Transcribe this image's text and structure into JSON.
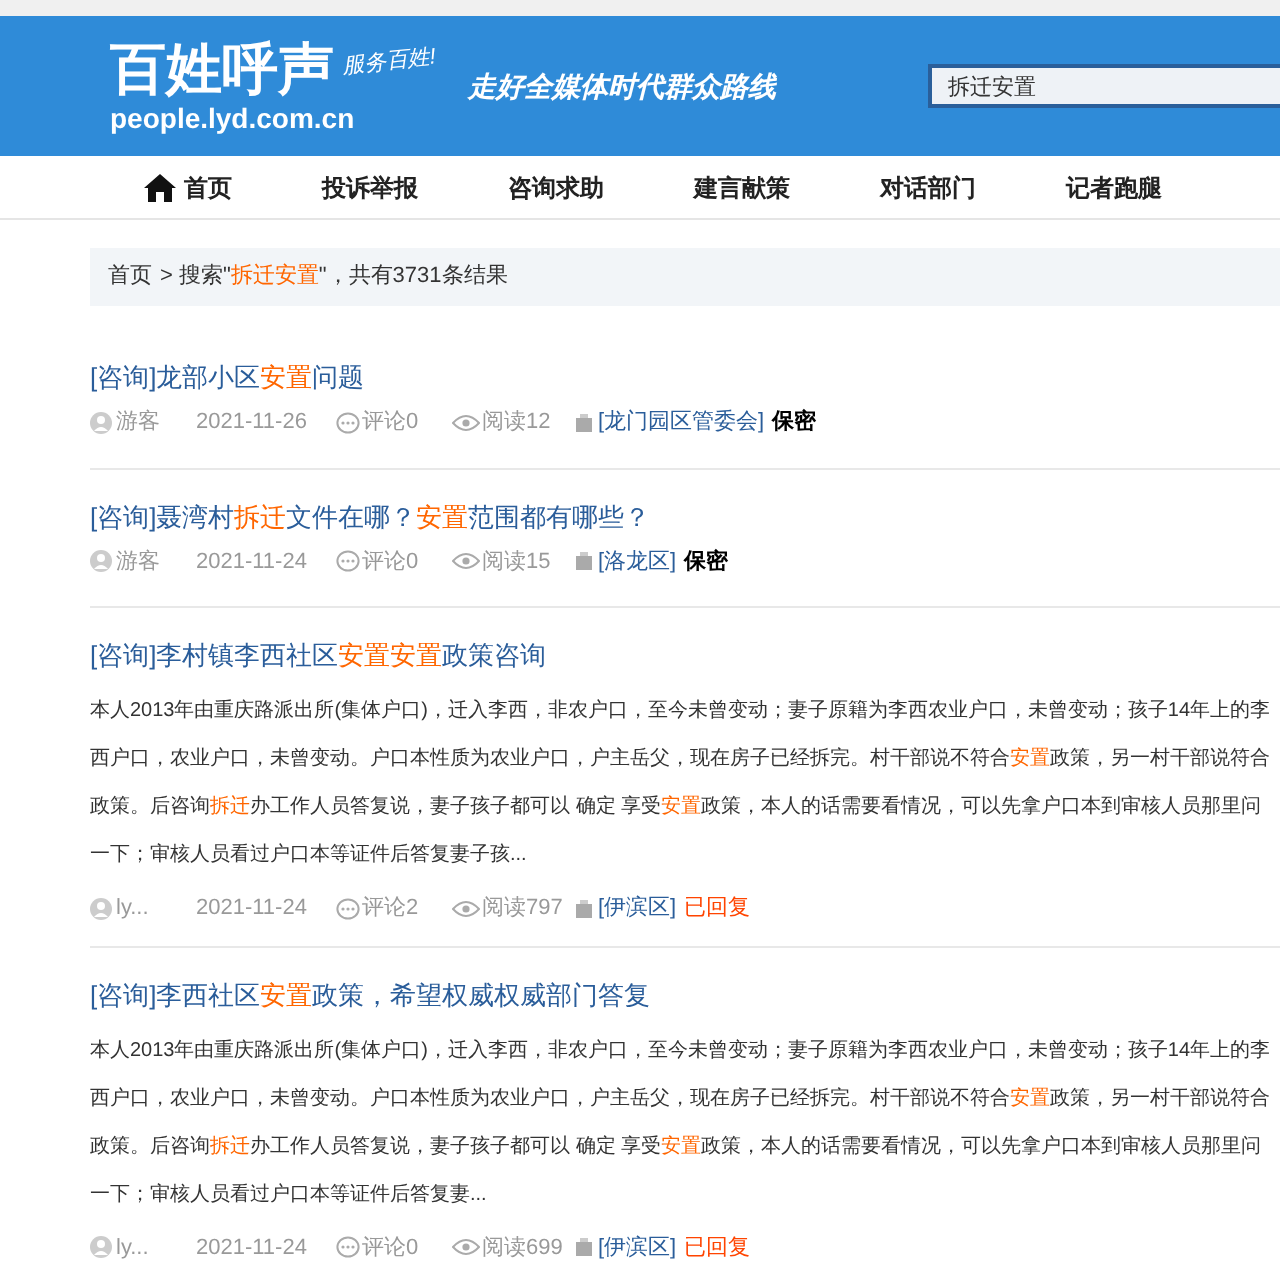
{
  "header": {
    "logo": "百姓呼声",
    "slogan": "服务百姓!",
    "domain": "people.lyd.com.cn",
    "tagline": "走好全媒体时代群众路线",
    "search": {
      "value": "拆迁安置"
    }
  },
  "nav": [
    {
      "label": "首页",
      "kind": "home"
    },
    {
      "label": "投诉举报",
      "kind": "plain"
    },
    {
      "label": "咨询求助",
      "kind": "plain"
    },
    {
      "label": "建言献策",
      "kind": "plain"
    },
    {
      "label": "对话部门",
      "kind": "plain"
    },
    {
      "label": "记者跑腿",
      "kind": "plain"
    }
  ],
  "breadcrumb": {
    "home": "首页",
    "text": "> 搜索\"**拆迁安置**\"，共有3731条结果"
  },
  "results": [
    {
      "title": "[咨询]龙部小区**安置**问题",
      "author": "游客",
      "date": "2021-11-26",
      "comments": "评论0",
      "views": "阅读12",
      "department": "[龙门园区管委会]",
      "status": {
        "text": "保密",
        "kind": "secret"
      }
    },
    {
      "title": "[咨询]聂湾村**拆迁**文件在哪？**安置**范围都有哪些？",
      "author": "游客",
      "date": "2021-11-24",
      "comments": "评论0",
      "views": "阅读15",
      "department": "[洛龙区]",
      "status": {
        "text": "保密",
        "kind": "secret"
      }
    },
    {
      "title": "[咨询]李村镇李西社区**安置安置**政策咨询",
      "summary": "本人2013年由重庆路派出所(集体户口)，迁入李西，非农户口，至今未曾变动；妻子原籍为李西农业户口，未曾变动；孩子14年上的李西户口，农业户口，未曾变动。户口本性质为农业户口，户主岳父，现在房子已经拆完。村干部说不符合**安置**政策，另一村干部说符合政策。后咨询**拆迁**办工作人员答复说，妻子孩子都可以 确定 享受**安置**政策，本人的话需要看情况，可以先拿户口本到审核人员那里问一下；审核人员看过户口本等证件后答复妻子孩...",
      "author": "ly...",
      "date": "2021-11-24",
      "comments": "评论2",
      "views": "阅读797",
      "department": "[伊滨区]",
      "status": {
        "text": "已回复",
        "kind": "replied"
      }
    },
    {
      "title": "[咨询]李西社区**安置**政策，希望权威权威部门答复",
      "summary": "本人2013年由重庆路派出所(集体户口)，迁入李西，非农户口，至今未曾变动；妻子原籍为李西农业户口，未曾变动；孩子14年上的李西户口，农业户口，未曾变动。户口本性质为农业户口，户主岳父，现在房子已经拆完。村干部说不符合**安置**政策，另一村干部说符合政策。后咨询**拆迁**办工作人员答复说，妻子孩子都可以 确定 享受**安置**政策，本人的话需要看情况，可以先拿户口本到审核人员那里问一下；审核人员看过户口本等证件后答复妻...",
      "author": "ly...",
      "date": "2021-11-24",
      "comments": "评论0",
      "views": "阅读699",
      "department": "[伊滨区]",
      "status": {
        "text": "已回复",
        "kind": "replied"
      }
    }
  ]
}
